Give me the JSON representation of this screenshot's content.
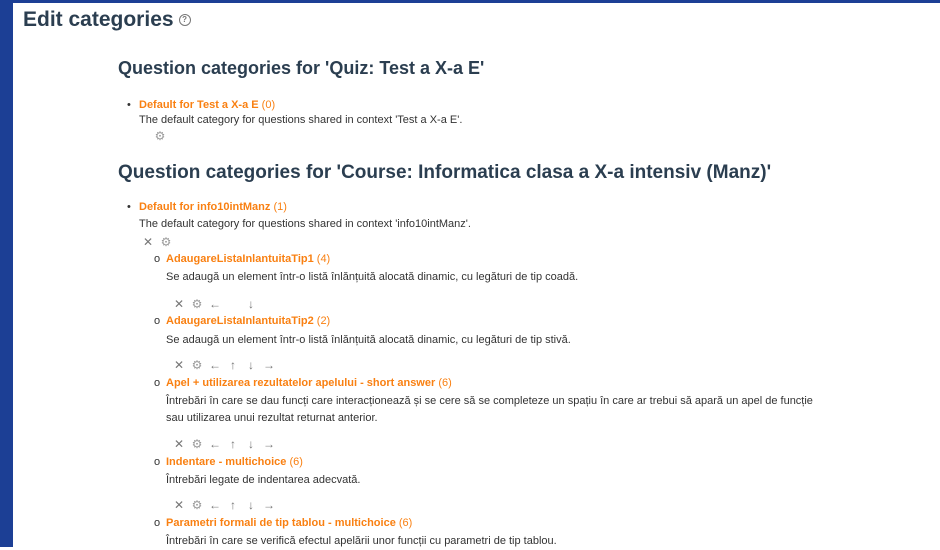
{
  "page": {
    "title": "Edit categories"
  },
  "sections": [
    {
      "heading": "Question categories for 'Quiz: Test a X-a E'",
      "top": {
        "name": "Default for Test a X-a E",
        "count": "(0)",
        "desc": "The default category for questions shared in context 'Test a X-a E'."
      }
    },
    {
      "heading": "Question categories for 'Course: Informatica clasa a X-a intensiv (Manz)'",
      "top": {
        "name": "Default for info10intManz",
        "count": "(1)",
        "desc": "The default category for questions shared in context 'info10intManz'."
      },
      "children": [
        {
          "name": "AdaugareListaInlantuitaTip1",
          "count": "(4)",
          "desc": "Se adaugă un element într-o listă înlănțuită alocată dinamic, cu legături de tip coadă."
        },
        {
          "name": "AdaugareListaInlantuitaTip2",
          "count": "(2)",
          "desc": "Se adaugă un element într-o listă înlănțuită alocată dinamic, cu legături de tip stivă."
        },
        {
          "name": "Apel + utilizarea rezultatelor apelului - short answer",
          "count": "(6)",
          "desc": "Întrebări în care se dau funcți care interacționează și se cere să se completeze un spațiu în care ar trebui să apară un apel de funcție",
          "desc2": "sau utilizarea unui rezultat returnat anterior."
        },
        {
          "name": "Indentare - multichoice",
          "count": "(6)",
          "desc": "Întrebări legate de indentarea adecvată."
        },
        {
          "name": "Parametri formali de tip tablou - multichoice",
          "count": "(6)",
          "desc": "Întrebări în care se verifică efectul apelării unor funcții cu parametri de tip tablou."
        }
      ]
    }
  ],
  "icons": {
    "delete": "✕",
    "edit": "⚙",
    "left": "←",
    "right": "→",
    "up": "↑",
    "down": "↓",
    "bullet_filled": "•",
    "bullet_open": "o"
  }
}
